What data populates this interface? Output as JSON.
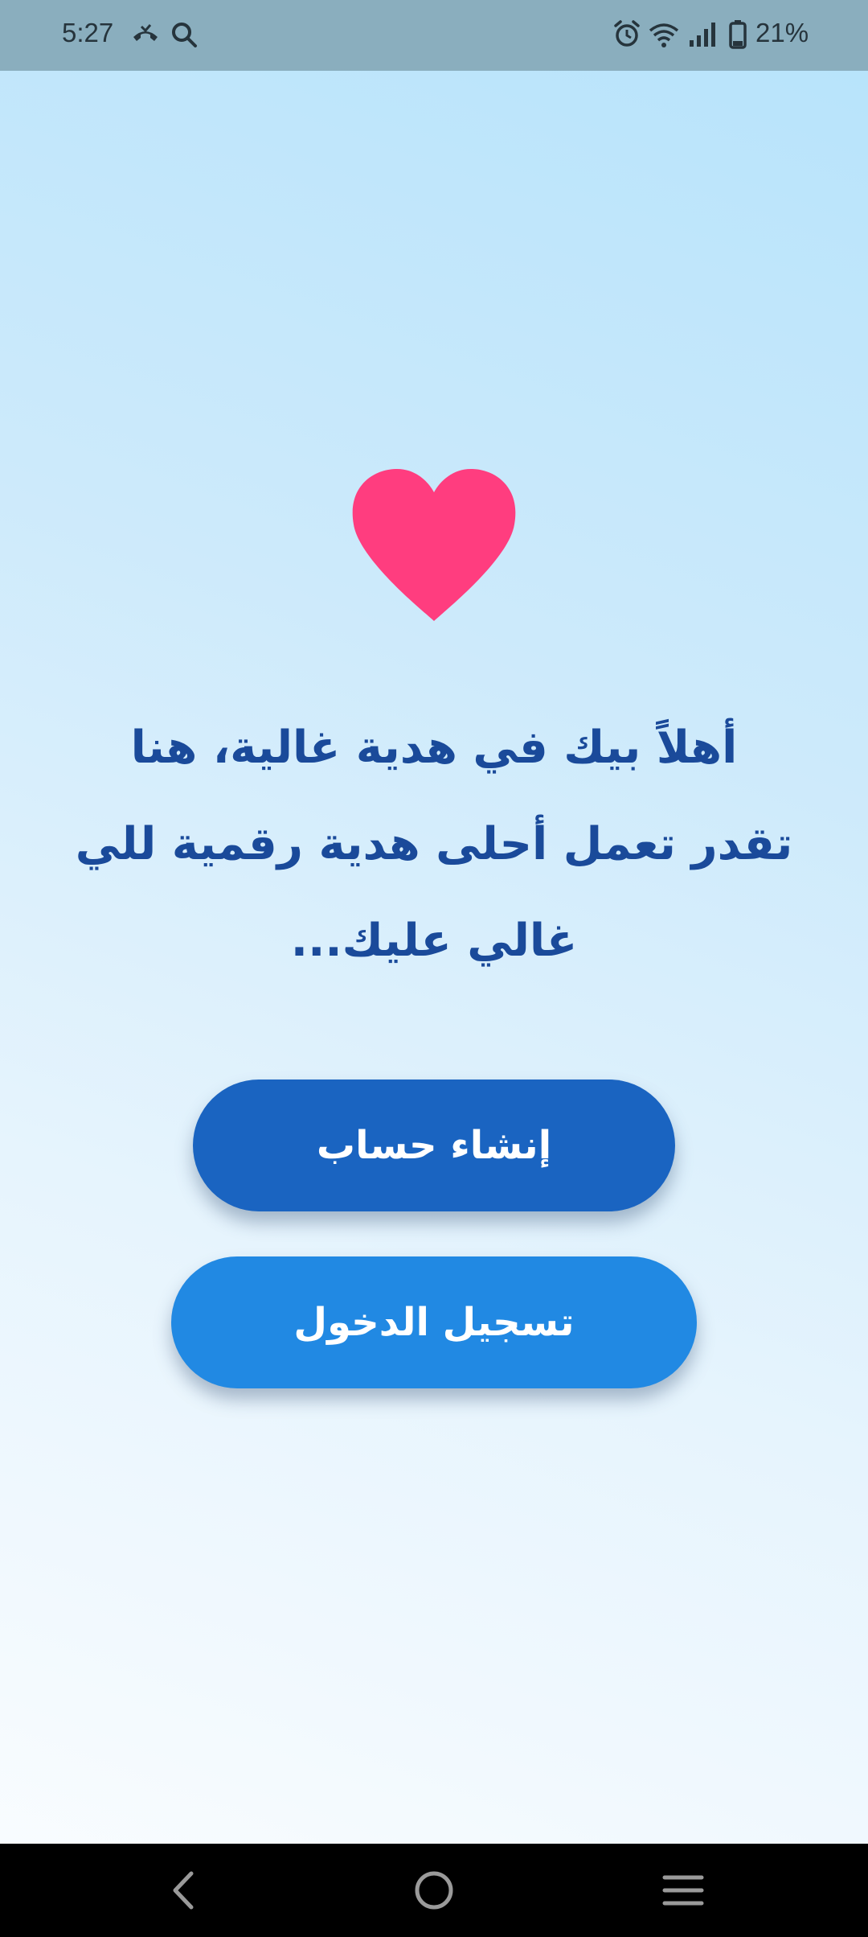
{
  "status_bar": {
    "time": "5:27",
    "battery_percent": "21%",
    "icons": [
      "missed-call-icon",
      "search-icon",
      "alarm-icon",
      "wifi-icon",
      "signal-icon",
      "battery-icon"
    ]
  },
  "main": {
    "icon": "heart-icon",
    "accent_color": "#ff3d7f",
    "welcome_text": "أهلاً بيك في هدية غالية، هنا تقدر تعمل أحلى هدية رقمية للي غالي عليك...",
    "create_account_label": "إنشاء حساب",
    "login_label": "تسجيل الدخول",
    "create_button_color": "#1a64c1",
    "login_button_color": "#2189e3",
    "text_color": "#1a4a9a"
  },
  "nav_bar": {
    "buttons": [
      "back-icon",
      "home-icon",
      "recents-icon"
    ]
  }
}
